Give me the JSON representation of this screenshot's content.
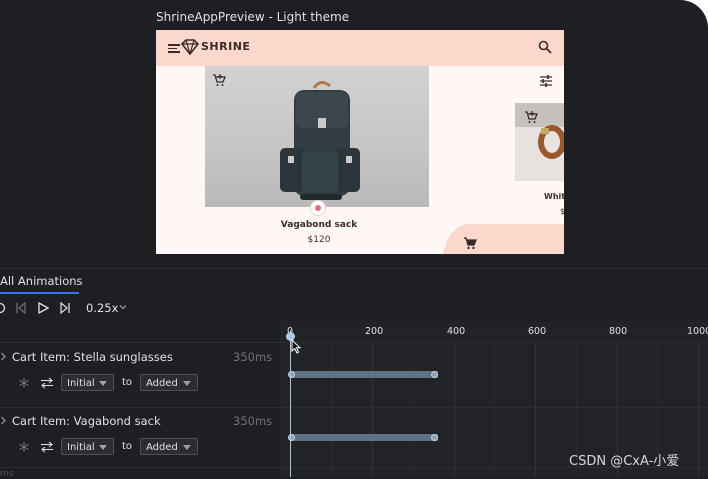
{
  "preview": {
    "title": "ShrineAppPreview - Light theme",
    "app": {
      "brand": "SHRINE",
      "product_name": "Vagabond sack",
      "product_price": "$120",
      "side_product_name": "Whit",
      "side_product_price": "$"
    }
  },
  "tabs": {
    "active_label": "All Animations"
  },
  "controls": {
    "speed": "0.25x"
  },
  "timeline": {
    "ticks": [
      "0",
      "200",
      "400",
      "600",
      "800",
      "1000"
    ],
    "rows": [
      {
        "title": "Cart Item: Stella sunglasses",
        "duration": "350ms",
        "from": "Initial",
        "to_label": "to",
        "to": "Added"
      },
      {
        "title": "Cart Item: Vagabond sack",
        "duration": "350ms",
        "from": "Initial",
        "to_label": "to",
        "to": "Added"
      }
    ]
  },
  "watermark": "CSDN @CxA-小爱",
  "bottom_partial": "ms",
  "colors": {
    "accent": "#3574f0",
    "appbar": "#fcd7cc",
    "bar": "#5e7286"
  }
}
